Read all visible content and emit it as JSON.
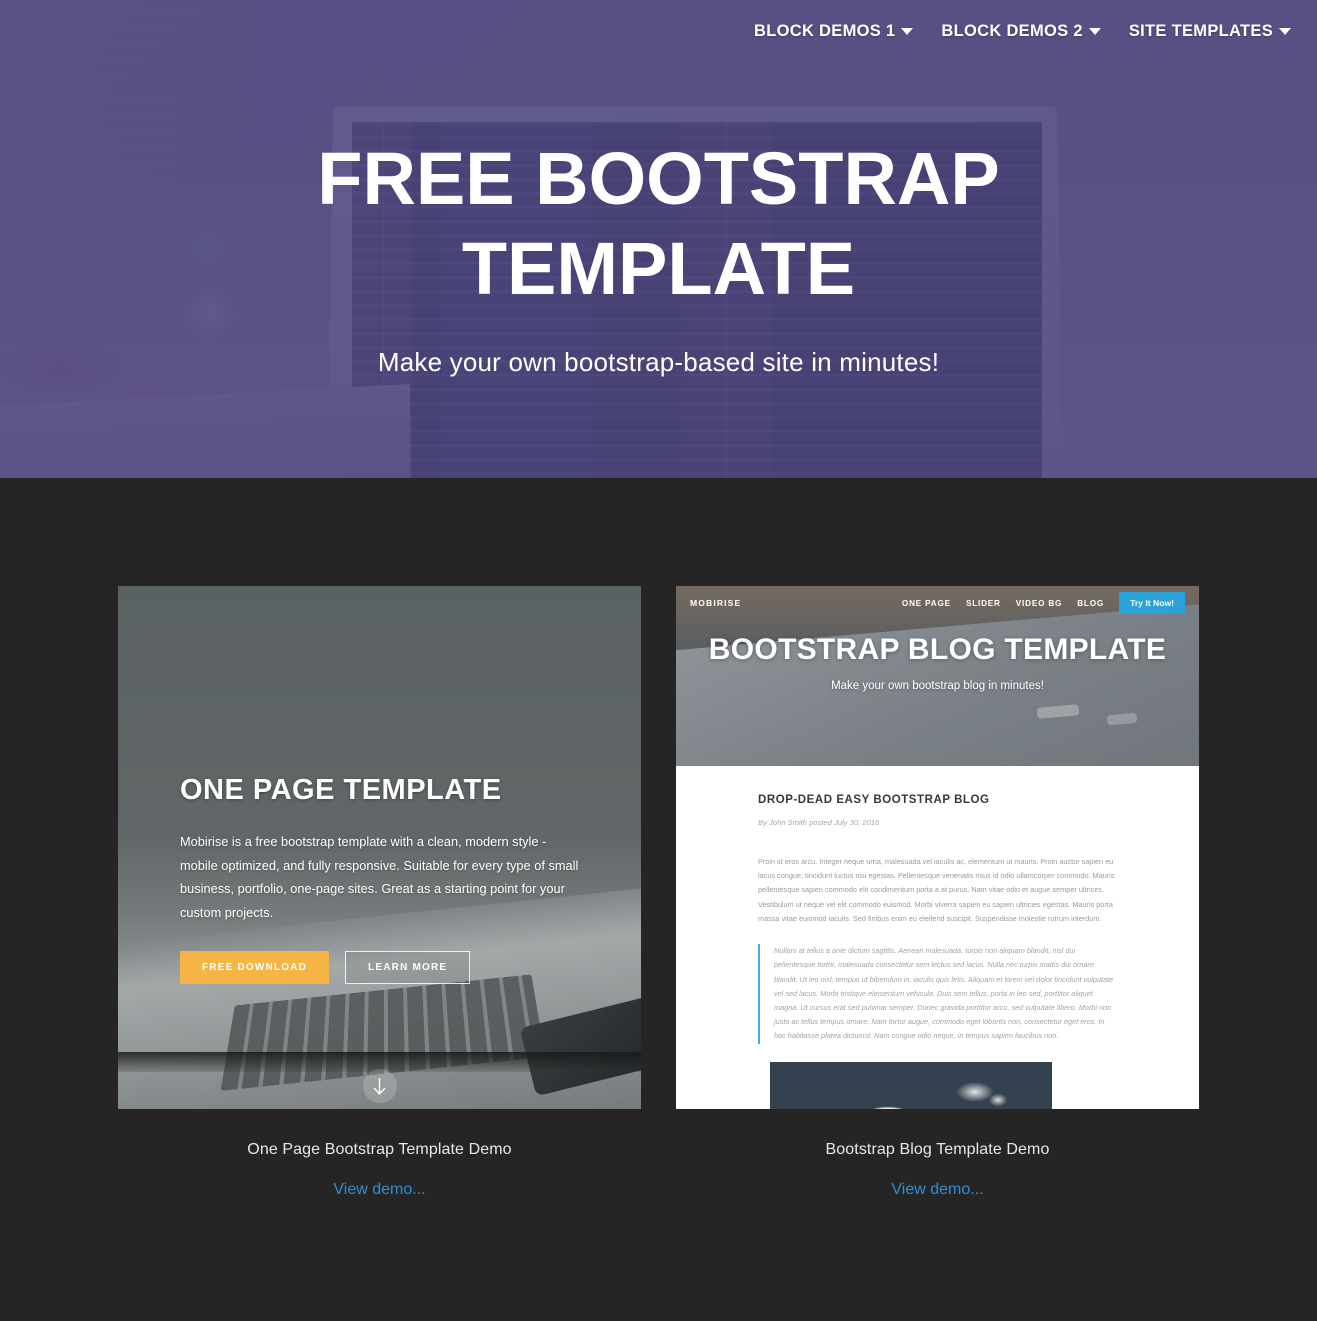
{
  "navbar": {
    "items": [
      {
        "label": "BLOCK DEMOS 1",
        "caret": "chevron-down-icon"
      },
      {
        "label": "BLOCK DEMOS 2",
        "caret": "chevron-down-icon"
      },
      {
        "label": "SITE TEMPLATES",
        "caret": "chevron-down-icon"
      }
    ]
  },
  "hero": {
    "title": "FREE BOOTSTRAP TEMPLATE",
    "subtitle": "Make your own bootstrap-based site in minutes!",
    "overlay_color": "#4f4880"
  },
  "demos": {
    "background_color": "#252525",
    "items": [
      {
        "caption": "One Page Bootstrap Template Demo",
        "link_label": "View demo...",
        "link_color": "#2f8fd8"
      },
      {
        "caption": "Bootstrap Blog Template Demo",
        "link_label": "View demo...",
        "link_color": "#2f8fd8"
      }
    ]
  },
  "onepage_preview": {
    "title": "ONE PAGE TEMPLATE",
    "body": "Mobirise is a free bootstrap template with a clean, modern style - mobile optimized, and fully responsive. Suitable for every type of small business, portfolio, one-page sites. Great as a starting point for your custom projects.",
    "primary_button": "FREE DOWNLOAD",
    "secondary_button": "LEARN MORE",
    "primary_button_color": "#f4b545",
    "scroll_icon": "arrow-down-icon"
  },
  "blog_preview": {
    "logo": "MOBIRISE",
    "nav": [
      "ONE PAGE",
      "SLIDER",
      "VIDEO BG",
      "BLOG"
    ],
    "cta_label": "Try It Now!",
    "cta_color": "#29a3d9",
    "hero_title": "BOOTSTRAP BLOG TEMPLATE",
    "hero_subtitle": "Make your own bootstrap blog in minutes!",
    "post_title": "DROP-DEAD EASY BOOTSTRAP BLOG",
    "byline": "By John Smith posted July 30, 2016",
    "paragraph": "Proin id eros arcu. Integer neque urna, malesuada vel iaculis ac, elementum ut mauris. Proin auctor sapien eu lacus congue, tincidunt luctus nisi egestas. Pellentesque venenatis risus id odio ullamcorper commodo. Mauris pellentesque sapien commodo elit condimentum porta a at purus. Nam vitae odio et augue semper ultrices. Vestibulum ut neque vel elit commodo euismod. Morbi viverra sapien eu sapien ultricies egestas. Mauris porta massa vitae euismod iaculis. Sed finibus enim eu eleifend suscipit. Suspendisse molestie rutrum interdum.",
    "quote": "Nullam at tellus a ante dictum sagittis. Aenean malesuada, turpis non aliquam blandit, nisl dui pellentesque tortor, malesuada consectetur sem lectus sed lacus. Nulla nec turpis mattis dui ornare blandit. Ut leo nisl, tempus ut bibendum in, iaculis quis felis. Aliquam et lorem vel dolor tincidunt vulputate vel sed lacus. Morbi tristique elementum vehicula. Duis sem tellus, porta in leo sed, porttitor aliquet magna. Ut cursus erat sed pulvinar semper. Donec gravida porttitor arcu, sed vulputate libero. Morbi non justo ac tellus tempus ornare. Nam tortor augue, commodo eget lobortis non, consectetur eget eros. In hac habitasse platea dictumst. Nam congue odio neque, in tempus sapien faucibus non."
  }
}
